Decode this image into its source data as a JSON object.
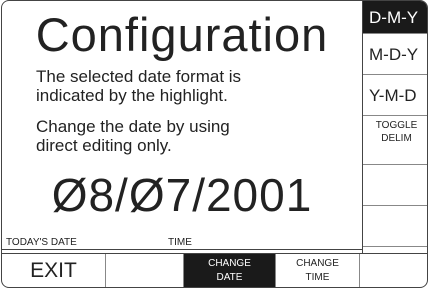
{
  "screen": {
    "title": "Configuration",
    "para1_line1": "The selected date format is",
    "para1_line2": "indicated by the highlight.",
    "para2_line1": "Change the date by using",
    "para2_line2": "direct editing only.",
    "date_value": "Ø8/Ø7/2001",
    "label_date": "TODAY'S DATE",
    "label_time": "TIME"
  },
  "format_menu": {
    "items": [
      {
        "label": "D-M-Y",
        "selected": true
      },
      {
        "label": "M-D-Y",
        "selected": false
      },
      {
        "label": "Y-M-D",
        "selected": false
      },
      {
        "label_line1": "TOGGLE",
        "label_line2": "DELIM"
      }
    ]
  },
  "softkeys": {
    "exit": "EXIT",
    "change_date_line1": "CHANGE",
    "change_date_line2": "DATE",
    "change_time_line1": "CHANGE",
    "change_time_line2": "TIME"
  },
  "colors": {
    "highlight": "#1a1a1a",
    "text": "#222222",
    "background": "#ffffff"
  }
}
